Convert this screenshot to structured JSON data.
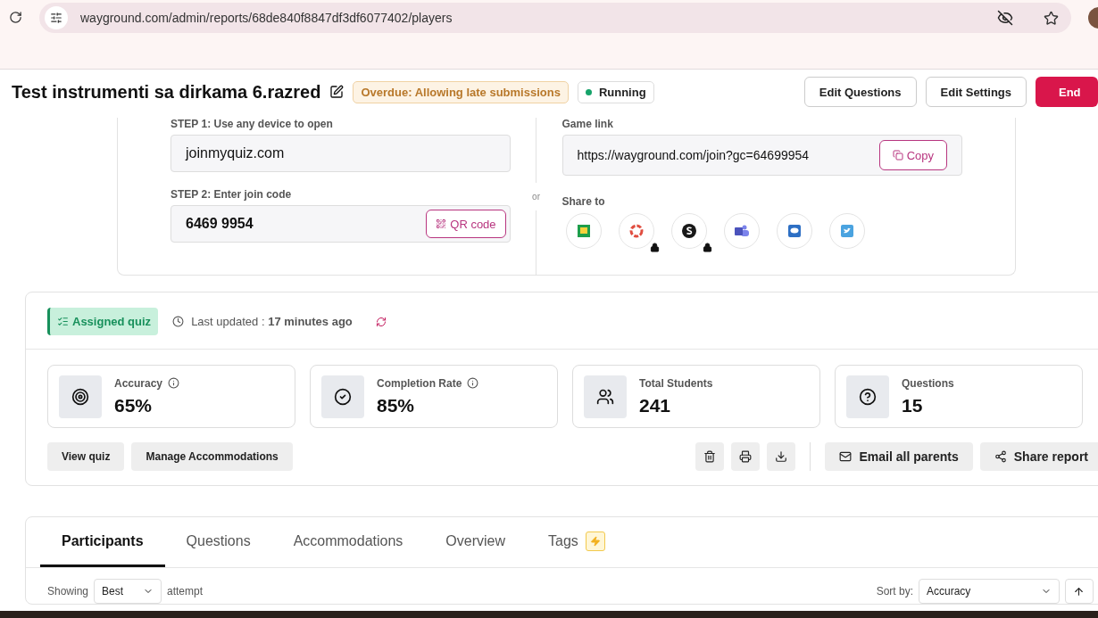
{
  "browser": {
    "url": "wayground.com/admin/reports/68de840f8847df3df6077402/players"
  },
  "header": {
    "title": "Test instrumenti sa dirkama 6.razred",
    "badges": [
      {
        "kind": "warning",
        "label": "Overdue: Allowing late submissions"
      },
      {
        "kind": "status",
        "label": "Running",
        "color": "#16a36a"
      }
    ],
    "buttons": [
      {
        "label": "Edit Questions",
        "kind": "outline"
      },
      {
        "label": "Edit Settings",
        "kind": "outline"
      },
      {
        "label": "End",
        "kind": "danger"
      }
    ]
  },
  "join": {
    "step1_label": "STEP 1: Use any device to open",
    "step1_value": "joinmyquiz.com",
    "step2_label": "STEP 2: Enter join code",
    "join_code": "6469 9954",
    "qr_button": "QR code",
    "or": "or",
    "game_link_label": "Game link",
    "game_link": "https://wayground.com/join?gc=64699954",
    "copy_button": "Copy",
    "share_label": "Share to",
    "share_targets": [
      {
        "kind": "board",
        "locked": false
      },
      {
        "kind": "ring",
        "locked": true
      },
      {
        "kind": "dot",
        "locked": true
      },
      {
        "kind": "people",
        "locked": false
      },
      {
        "kind": "chat",
        "locked": false
      },
      {
        "kind": "bird",
        "locked": false
      }
    ]
  },
  "report": {
    "tag": "Assigned quiz",
    "last_updated_label": "Last updated :",
    "last_updated_value": "17 minutes ago",
    "stats": [
      {
        "kind": "target",
        "label": "Accuracy",
        "info": true,
        "value": "65%"
      },
      {
        "kind": "check",
        "label": "Completion Rate",
        "info": true,
        "value": "85%"
      },
      {
        "kind": "people",
        "label": "Total Students",
        "info": false,
        "value": "241"
      },
      {
        "kind": "question",
        "label": "Questions",
        "info": false,
        "value": "15"
      }
    ],
    "left_buttons": [
      "View quiz",
      "Manage Accommodations"
    ],
    "icon_buttons": [
      {
        "kind": "delete"
      },
      {
        "kind": "print"
      },
      {
        "kind": "download"
      }
    ],
    "right_buttons": [
      {
        "kind": "mail",
        "label": "Email all parents"
      },
      {
        "kind": "share",
        "label": "Share report"
      }
    ]
  },
  "tabs": [
    {
      "label": "Participants",
      "selected": true,
      "badge": false
    },
    {
      "label": "Questions",
      "selected": false,
      "badge": false
    },
    {
      "label": "Accommodations",
      "selected": false,
      "badge": false
    },
    {
      "label": "Overview",
      "selected": false,
      "badge": false
    },
    {
      "label": "Tags",
      "selected": false,
      "badge": true
    }
  ],
  "filters": {
    "showing_label": "Showing",
    "attempt_value": "Best",
    "attempt_label": "attempt",
    "sort_label": "Sort by:",
    "sort_value": "Accuracy"
  }
}
